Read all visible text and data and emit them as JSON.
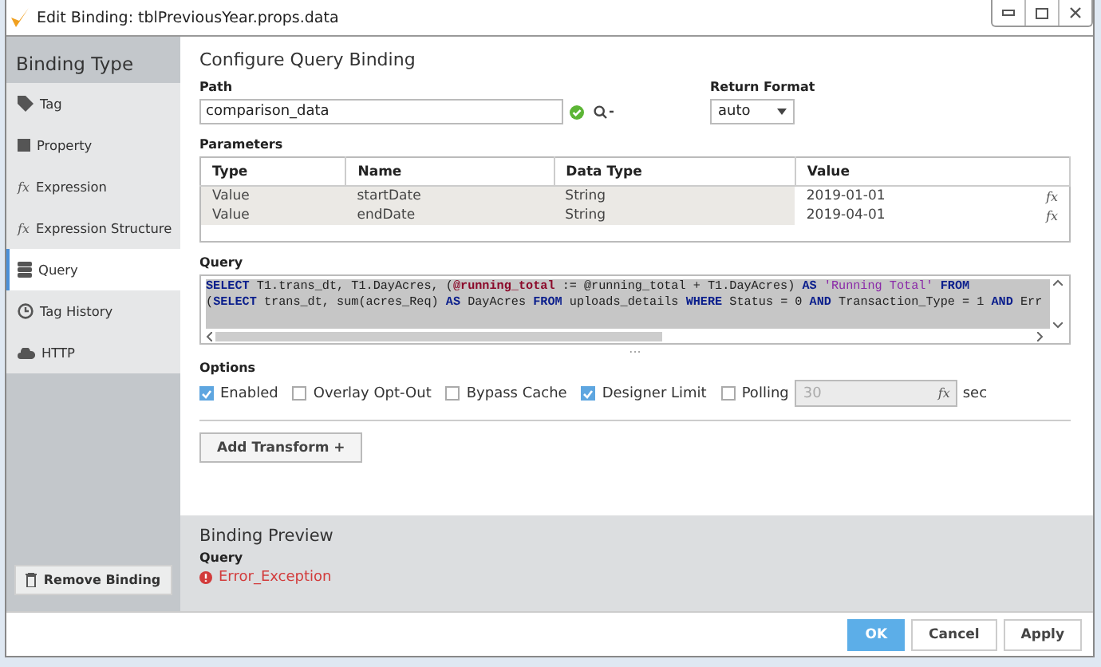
{
  "window": {
    "title": "Edit Binding: tblPreviousYear.props.data"
  },
  "sidebar": {
    "heading": "Binding Type",
    "items": [
      {
        "label": "Tag",
        "kind": "tag",
        "selected": false
      },
      {
        "label": "Property",
        "kind": "property",
        "selected": false
      },
      {
        "label": "Expression",
        "kind": "expression",
        "icon": "fx",
        "selected": false
      },
      {
        "label": "Expression Structure",
        "kind": "expression",
        "icon": "fx",
        "selected": false
      },
      {
        "label": "Query",
        "kind": "query",
        "selected": true
      },
      {
        "label": "Tag History",
        "kind": "history",
        "selected": false
      },
      {
        "label": "HTTP",
        "kind": "http",
        "selected": false
      }
    ],
    "remove_button": "Remove Binding"
  },
  "config": {
    "title": "Configure Query Binding",
    "path": {
      "label": "Path",
      "value": "comparison_data",
      "valid": true
    },
    "return_format": {
      "label": "Return Format",
      "value": "auto"
    },
    "parameters": {
      "label": "Parameters",
      "columns": [
        "Type",
        "Name",
        "Data Type",
        "Value"
      ],
      "rows": [
        {
          "type": "Value",
          "name": "startDate",
          "data_type": "String",
          "value": "2019-01-01",
          "icon": "fx"
        },
        {
          "type": "Value",
          "name": "endDate",
          "data_type": "String",
          "value": "2019-04-01",
          "icon": "fx"
        }
      ]
    },
    "query": {
      "label": "Query",
      "lines": [
        [
          {
            "kind": "keyword",
            "text": "SELECT"
          },
          {
            "kind": "plain",
            "text": " T1.trans_dt, T1.DayAcres, ("
          },
          {
            "kind": "variable",
            "text": "@running_total"
          },
          {
            "kind": "plain",
            "text": " := @running_total + T1.DayAcres) "
          },
          {
            "kind": "keyword",
            "text": "AS"
          },
          {
            "kind": "string",
            "text": " 'Running Total' "
          },
          {
            "kind": "keyword",
            "text": "FROM"
          }
        ],
        [
          {
            "kind": "plain",
            "text": "("
          },
          {
            "kind": "keyword",
            "text": "SELECT"
          },
          {
            "kind": "plain",
            "text": " trans_dt, sum(acres_Req) "
          },
          {
            "kind": "keyword",
            "text": "AS"
          },
          {
            "kind": "plain",
            "text": " DayAcres "
          },
          {
            "kind": "keyword",
            "text": "FROM"
          },
          {
            "kind": "plain",
            "text": " uploads_details "
          },
          {
            "kind": "keyword",
            "text": "WHERE"
          },
          {
            "kind": "plain",
            "text": " Status = 0 "
          },
          {
            "kind": "keyword",
            "text": "AND"
          },
          {
            "kind": "plain",
            "text": " Transaction_Type = 1 "
          },
          {
            "kind": "keyword",
            "text": "AND"
          },
          {
            "kind": "plain",
            "text": " Err"
          }
        ]
      ]
    },
    "handle": "...",
    "options": {
      "label": "Options",
      "items": [
        {
          "label": "Enabled",
          "checked": true
        },
        {
          "label": "Overlay Opt-Out",
          "checked": false
        },
        {
          "label": "Bypass Cache",
          "checked": false
        },
        {
          "label": "Designer Limit",
          "checked": true
        },
        {
          "label": "Polling",
          "checked": false
        }
      ],
      "polling": {
        "value": "30",
        "icon": "fx",
        "disabled": true,
        "unit": "sec"
      }
    },
    "transform_button": "Add Transform +"
  },
  "preview": {
    "title": "Binding Preview",
    "label": "Query",
    "error": "Error_Exception"
  },
  "footer": {
    "buttons": [
      {
        "label": "OK",
        "primary": true
      },
      {
        "label": "Cancel",
        "primary": false
      },
      {
        "label": "Apply",
        "primary": false
      }
    ]
  }
}
